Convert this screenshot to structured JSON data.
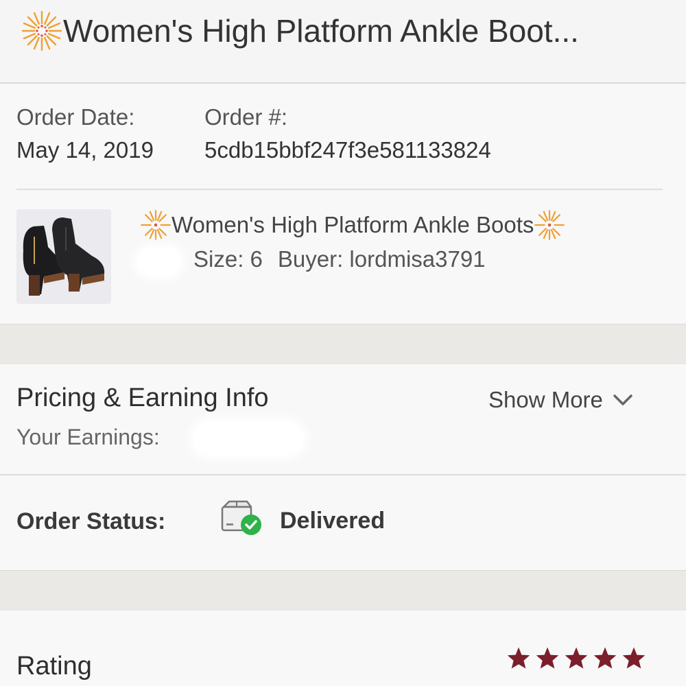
{
  "header": {
    "title": "Women's High Platform Ankle Boot...",
    "icon": "sunburst-icon",
    "accent": "#f0a030"
  },
  "order": {
    "date_label": "Order Date:",
    "date_value": "May 14, 2019",
    "number_label": "Order #:",
    "number_value": "5cdb15bbf247f3e581133824"
  },
  "item": {
    "title": "Women's High Platform Ankle Boots",
    "size_text": "Size: 6",
    "buyer_text": "Buyer: lordmisa3791",
    "thumbnail": "boots-photo"
  },
  "pricing": {
    "title": "Pricing & Earning Info",
    "show_more": "Show More",
    "earnings_label": "Your Earnings:"
  },
  "status": {
    "label": "Order Status:",
    "value": "Delivered",
    "icon": "package-delivered-icon",
    "check_color": "#2eb24a"
  },
  "rating": {
    "label": "Rating",
    "stars": 5,
    "star_color": "#7a1f2b"
  }
}
